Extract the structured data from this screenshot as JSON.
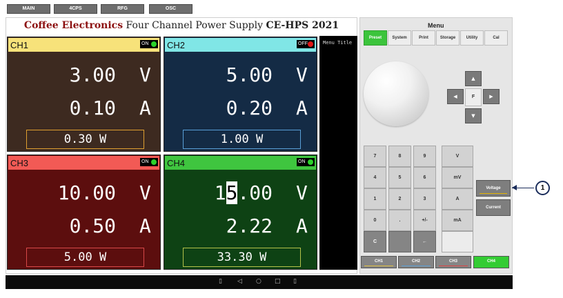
{
  "top_tabs": [
    "MAIN",
    "4CPS",
    "RFG",
    "OSC"
  ],
  "title": {
    "brand": "Coffee Electronics",
    "subtitle": "Four Channel Power Supply",
    "model": "CE-HPS 2021"
  },
  "menu_title": "Menu Title",
  "channels": [
    {
      "name": "CH1",
      "status": "ON",
      "voltage": "3.00",
      "voltage_unit": "V",
      "current": "0.10",
      "current_unit": "A",
      "power": "0.30 W",
      "head_color": "#f7e27a",
      "body_color": "#3d2a20",
      "watt_border": "#e0a030"
    },
    {
      "name": "CH2",
      "status": "OFF",
      "voltage": "5.00",
      "voltage_unit": "V",
      "current": "0.20",
      "current_unit": "A",
      "power": "1.00 W",
      "head_color": "#80e6e6",
      "body_color": "#142b45",
      "watt_border": "#5aa0d8"
    },
    {
      "name": "CH3",
      "status": "ON",
      "voltage": "10.00",
      "voltage_unit": "V",
      "current": "0.50",
      "current_unit": "A",
      "power": "5.00 W",
      "head_color": "#f25a55",
      "body_color": "#5c0e0e",
      "watt_border": "#d84848"
    },
    {
      "name": "CH4",
      "status": "ON",
      "voltage_pre": "1",
      "voltage_cursor": "5",
      "voltage_post": ".00",
      "voltage_unit": "V",
      "current": "2.22",
      "current_unit": "A",
      "power": "33.30 W",
      "head_color": "#3fc53f",
      "body_color": "#0e4214",
      "watt_border": "#b5c24a"
    }
  ],
  "menu": {
    "label": "Menu",
    "items": [
      "Preset",
      "System",
      "Print",
      "Storage",
      "Utility",
      "Cal"
    ],
    "active": "Preset"
  },
  "arrows": {
    "up": "▲",
    "left": "◀",
    "right": "▶",
    "down": "▼",
    "center": "F"
  },
  "keypad": {
    "keys": [
      "7",
      "8",
      "9",
      "4",
      "5",
      "6",
      "1",
      "2",
      "3",
      "0",
      ".",
      "+/-",
      "C",
      "",
      "←"
    ],
    "units": [
      "V",
      "mV",
      "A",
      "mA",
      ""
    ]
  },
  "side_buttons": [
    "Voltage",
    "Current"
  ],
  "callout": "1",
  "channel_tabs": [
    {
      "label": "CH1",
      "underline": "#e0c040"
    },
    {
      "label": "CH2",
      "underline": "#5aa0d8"
    },
    {
      "label": "CH3",
      "underline": "#e04040"
    },
    {
      "label": "CH4",
      "underline": "#3fc53f"
    }
  ],
  "active_channel_tab": "CH4",
  "navbar_icons": [
    "▯",
    "◁",
    "○",
    "□",
    "▯"
  ],
  "colors": {
    "accent_green": "#3cc43c",
    "brand_red": "#8c1010"
  }
}
